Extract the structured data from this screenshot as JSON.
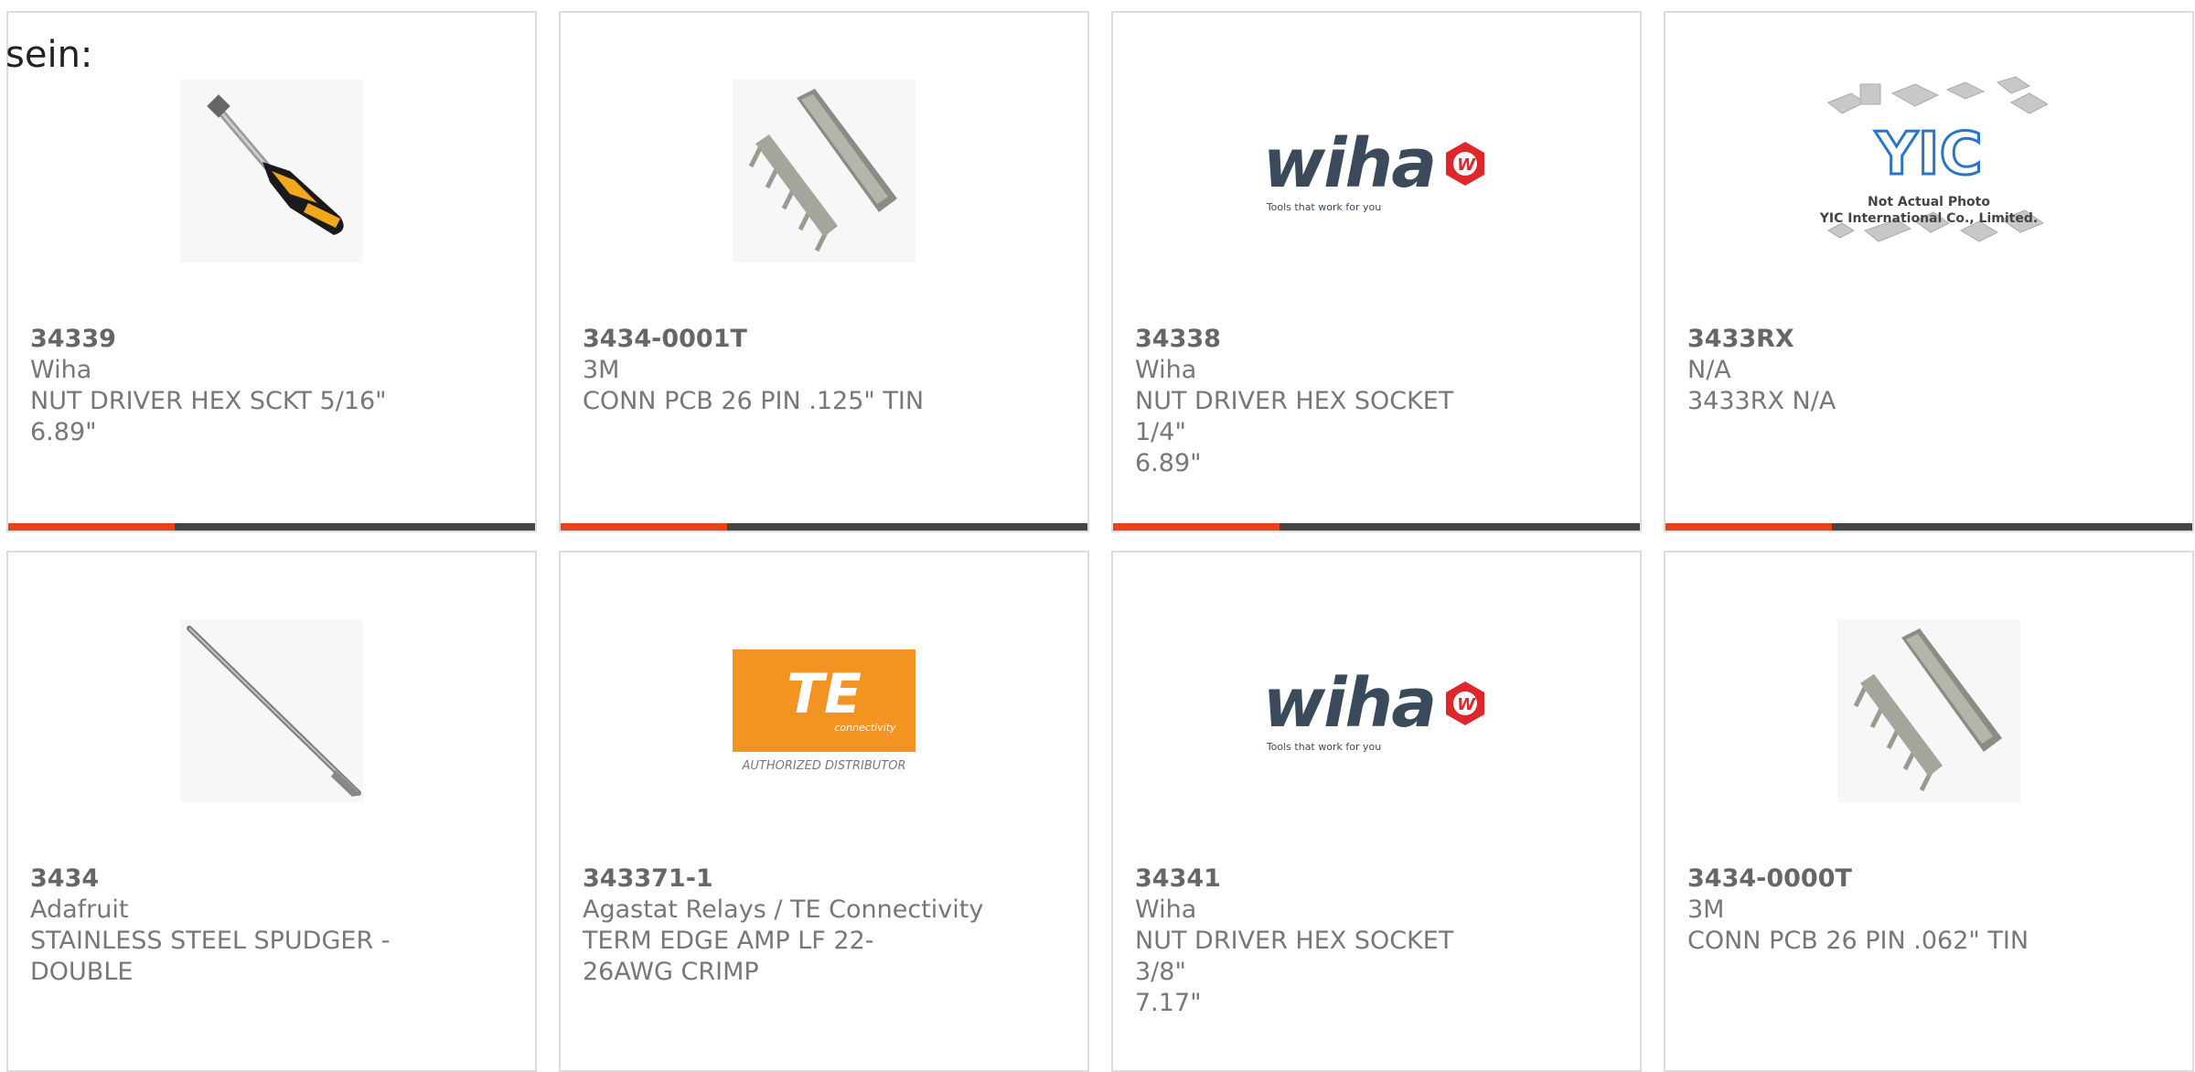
{
  "intro_text": "sein:",
  "colors": {
    "accent": "#e8421a",
    "bar": "#444444",
    "border": "#dcdcdc"
  },
  "products": [
    {
      "part_number": "34339",
      "manufacturer": "Wiha",
      "description": "NUT DRIVER HEX SCKT 5/16\"",
      "extra": "6.89\"",
      "image": "nut-driver-photo"
    },
    {
      "part_number": "3434-0001T",
      "manufacturer": "3M",
      "description": "CONN PCB 26 PIN .125\" TIN",
      "extra": "",
      "image": "pcb-connector-photo"
    },
    {
      "part_number": "34338",
      "manufacturer": "Wiha",
      "description": "NUT DRIVER HEX SOCKET 1/4\"",
      "extra": "6.89\"",
      "image": "wiha-logo"
    },
    {
      "part_number": "3433RX",
      "manufacturer": "N/A",
      "description": "3433RX N/A",
      "extra": "",
      "image": "yic-placeholder"
    },
    {
      "part_number": "3434",
      "manufacturer": "Adafruit",
      "description": "STAINLESS STEEL SPUDGER - DOUBLE",
      "extra": "",
      "image": "spudger-photo"
    },
    {
      "part_number": "343371-1",
      "manufacturer": "Agastat Relays / TE Connectivity",
      "description": "TERM EDGE AMP LF 22-26AWG CRIMP",
      "extra": "",
      "image": "te-logo"
    },
    {
      "part_number": "34341",
      "manufacturer": "Wiha",
      "description": "NUT DRIVER HEX SOCKET 3/8\"",
      "extra": "7.17\"",
      "image": "wiha-logo"
    },
    {
      "part_number": "3434-0000T",
      "manufacturer": "3M",
      "description": "CONN PCB 26 PIN .062\" TIN",
      "extra": "",
      "image": "pcb-connector-photo"
    }
  ],
  "logos": {
    "wiha_word": "wiha",
    "wiha_tag": "Tools that work for you",
    "te_word": "TE",
    "te_sub": "connectivity",
    "te_caption": "AUTHORIZED DISTRIBUTOR",
    "yic_line1": "Not Actual Photo",
    "yic_line2": "YIC International Co., Limited."
  }
}
